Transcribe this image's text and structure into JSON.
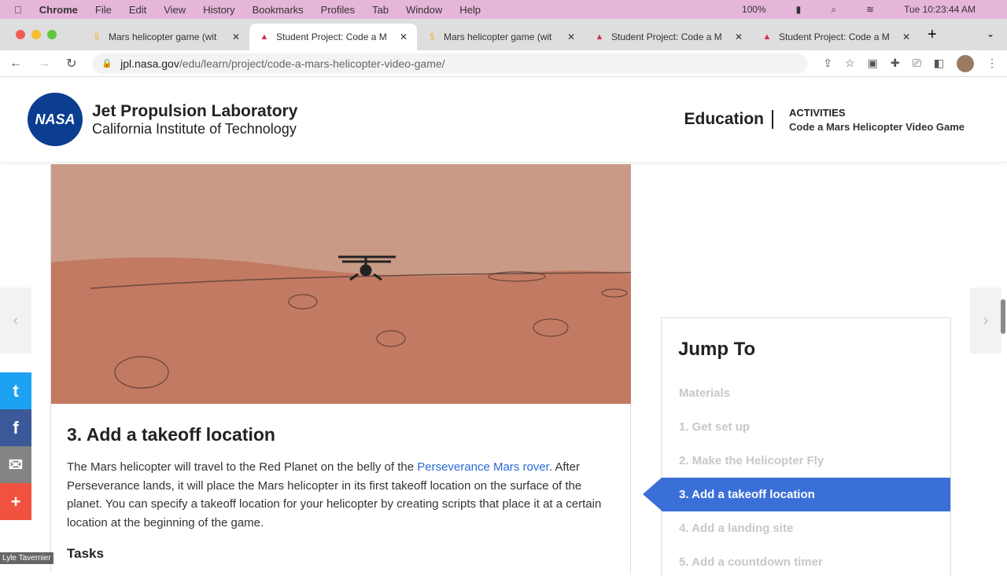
{
  "menubar": {
    "items": [
      "Chrome",
      "File",
      "Edit",
      "View",
      "History",
      "Bookmarks",
      "Profiles",
      "Tab",
      "Window",
      "Help"
    ],
    "battery": "100%",
    "clock": "Tue 10:23:44 AM"
  },
  "tabs": [
    {
      "title": "Mars helicopter game (wit",
      "active": false,
      "icon": "scratch-icon"
    },
    {
      "title": "Student Project: Code a M",
      "active": true,
      "icon": "jpl-icon"
    },
    {
      "title": "Mars helicopter game (wit",
      "active": false,
      "icon": "scratch-icon"
    },
    {
      "title": "Student Project: Code a M",
      "active": false,
      "icon": "jpl-icon"
    },
    {
      "title": "Student Project: Code a M",
      "active": false,
      "icon": "jpl-icon"
    }
  ],
  "address": {
    "domain": "jpl.nasa.gov",
    "path": "/edu/learn/project/code-a-mars-helicopter-video-game/"
  },
  "header": {
    "logo": "NASA",
    "title": "Jet Propulsion Laboratory",
    "subtitle": "California Institute of Technology",
    "section": "Education",
    "crumb_top": "ACTIVITIES",
    "crumb_bottom": "Code a Mars Helicopter Video Game"
  },
  "article": {
    "heading": "3. Add a takeoff location",
    "p_before": "The Mars helicopter will travel to the Red Planet on the belly of the ",
    "link": "Perseverance Mars rover",
    "p_after": ". After Perseverance lands, it will place the Mars helicopter in its first takeoff location on the surface of the planet. You can specify a takeoff location for your helicopter by creating scripts that place it at a certain location at the beginning of the game.",
    "subheading": "Tasks"
  },
  "jump": {
    "title": "Jump To",
    "items": [
      "Materials",
      "1. Get set up",
      "2. Make the Helicopter Fly",
      "3. Add a takeoff location",
      "4. Add a landing site",
      "5. Add a countdown timer"
    ],
    "active_index": 3
  },
  "colors": {
    "accent": "#3b6fd8",
    "link": "#2a6ad8"
  },
  "presenter": "Lyle Tavernier"
}
